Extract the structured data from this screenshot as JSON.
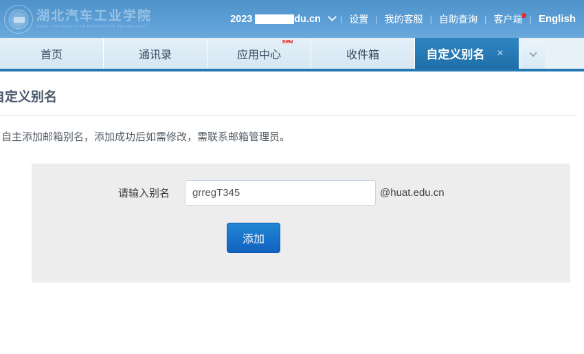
{
  "header": {
    "logo": {
      "name_cn": "湖北汽车工业学院",
      "name_en": "HUBEI UNIVERSITY OF AUTOMOTIVE TECHNOLOGY"
    },
    "account_email": "2023        @huat.edu.cn",
    "nav": [
      {
        "label": "设置",
        "badge": false
      },
      {
        "label": "我的客服",
        "badge": false
      },
      {
        "label": "自助查询",
        "badge": false
      },
      {
        "label": "客户端",
        "badge": true
      },
      {
        "label": "English",
        "badge": false
      }
    ],
    "separator": "|"
  },
  "tabs": {
    "items": [
      {
        "label": "首页",
        "active": false,
        "new_badge": ""
      },
      {
        "label": "通讯录",
        "active": false,
        "new_badge": ""
      },
      {
        "label": "应用中心",
        "active": false,
        "new_badge": "new"
      },
      {
        "label": "收件箱",
        "active": false,
        "new_badge": ""
      },
      {
        "label": "自定义别名",
        "active": true,
        "new_badge": ""
      }
    ],
    "close_glyph": "×",
    "dropdown_name": "tab-list-dropdown"
  },
  "main": {
    "page_title": "自定义别名",
    "description": "自主添加邮箱别名，添加成功后如需修改，需联系邮箱管理员。",
    "form": {
      "label": "请输入别名",
      "input_value": "grregT345",
      "input_placeholder": "",
      "domain_suffix": "@huat.edu.cn",
      "submit_label": "添加"
    }
  },
  "colors": {
    "header_blue": "#5b9ed6",
    "tab_active_blue": "#2378b4",
    "tab_inactive": "#dce9f3",
    "button_blue": "#1162c0",
    "badge_red": "#e8272c",
    "panel_gray": "#ededed"
  }
}
